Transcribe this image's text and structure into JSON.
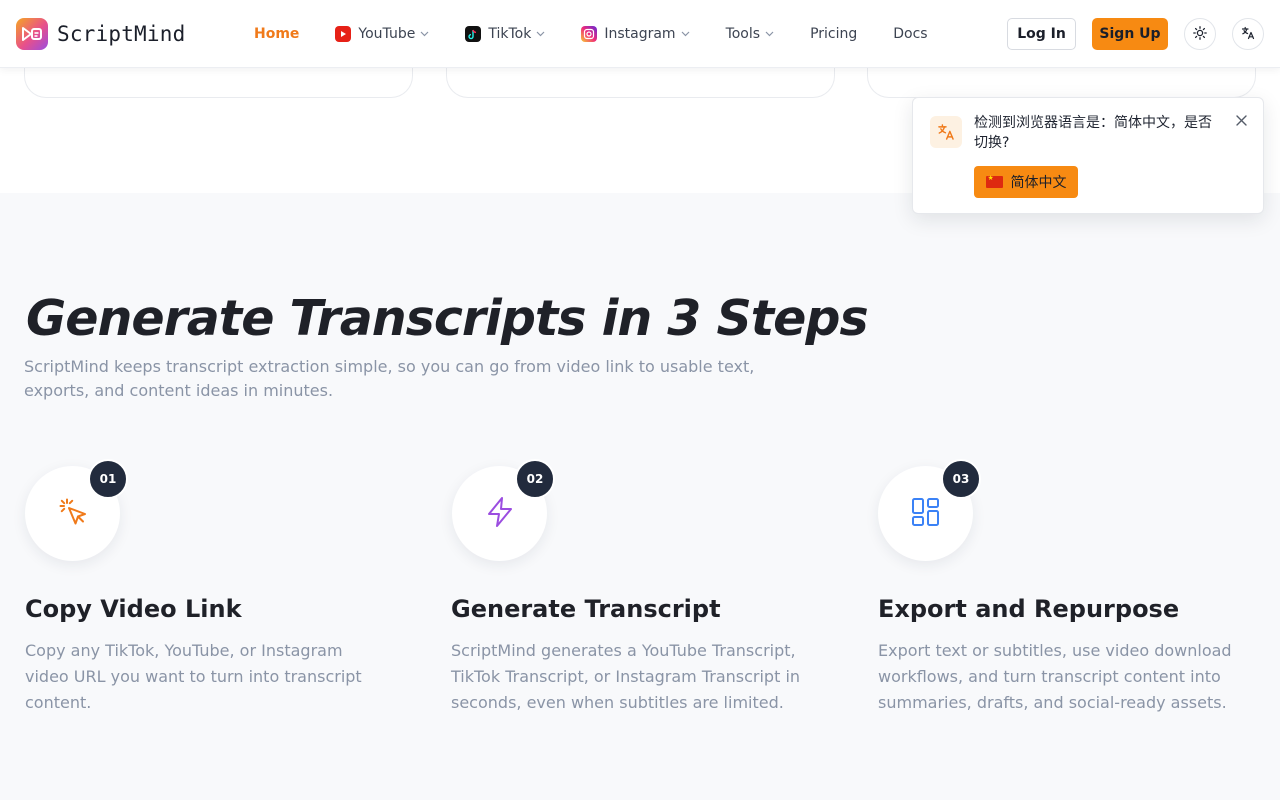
{
  "brand": {
    "name": "ScriptMind"
  },
  "nav": {
    "items": [
      {
        "label": "Home",
        "icon": "",
        "dropdown": false,
        "active": true
      },
      {
        "label": "YouTube",
        "icon": "youtube-icon",
        "dropdown": true,
        "active": false
      },
      {
        "label": "TikTok",
        "icon": "tiktok-icon",
        "dropdown": true,
        "active": false
      },
      {
        "label": "Instagram",
        "icon": "instagram-icon",
        "dropdown": true,
        "active": false
      },
      {
        "label": "Tools",
        "icon": "",
        "dropdown": true,
        "active": false
      },
      {
        "label": "Pricing",
        "icon": "",
        "dropdown": false,
        "active": false
      },
      {
        "label": "Docs",
        "icon": "",
        "dropdown": false,
        "active": false
      }
    ]
  },
  "auth": {
    "login_label": "Log In",
    "signup_label": "Sign Up"
  },
  "header_icons": {
    "theme": "sun-icon",
    "language": "translate-icon"
  },
  "section": {
    "title": "Generate Transcripts in 3 Steps",
    "subtitle": "ScriptMind keeps transcript extraction simple, so you can go from video link to usable text, exports, and content ideas in minutes.",
    "steps": [
      {
        "number": "01",
        "title": "Copy Video Link",
        "description": "Copy any TikTok, YouTube, or Instagram video URL you want to turn into transcript content.",
        "icon": "cursor-click-icon"
      },
      {
        "number": "02",
        "title": "Generate Transcript",
        "description": "ScriptMind generates a YouTube Transcript, TikTok Transcript, or Instagram Transcript in seconds, even when subtitles are limited.",
        "icon": "lightning-icon"
      },
      {
        "number": "03",
        "title": "Export and Repurpose",
        "description": "Export text or subtitles, use video download workflows, and turn transcript content into summaries, drafts, and social-ready assets.",
        "icon": "dashboard-icon"
      }
    ]
  },
  "language_popup": {
    "message": "检测到浏览器语言是：简体中文，是否切换?",
    "button_label": "简体中文"
  },
  "colors": {
    "accent": "#f78a12",
    "active_nav": "#f07a1a",
    "heading": "#1f2128",
    "muted": "#8a94a6",
    "badge": "#222b3d"
  }
}
